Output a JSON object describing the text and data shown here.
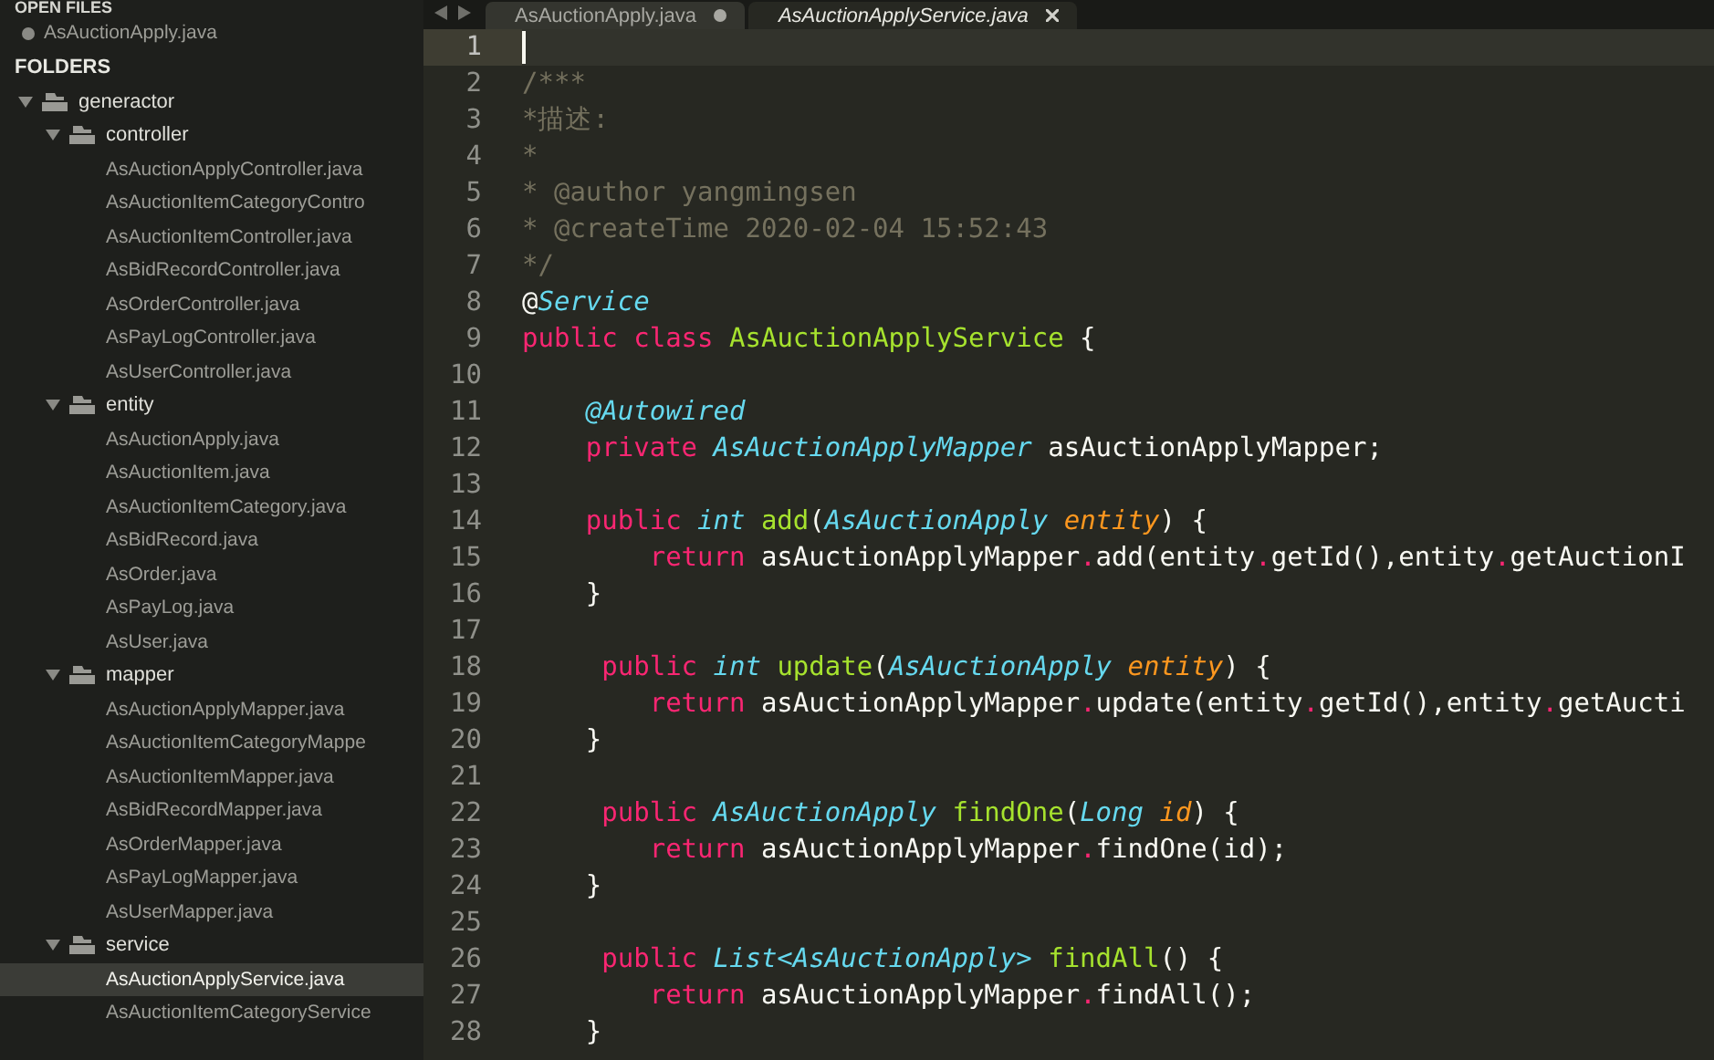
{
  "sidebar": {
    "open_files_header": "OPEN FILES",
    "open_files": [
      {
        "name": "AsAuctionApply.java"
      }
    ],
    "folders_header": "FOLDERS",
    "tree": [
      {
        "name": "generactor",
        "kind": "folder",
        "expanded": true,
        "children": [
          {
            "name": "controller",
            "kind": "folder",
            "expanded": true,
            "children": [
              {
                "name": "AsAuctionApplyController.java",
                "kind": "file",
                "selected": false
              },
              {
                "name": "AsAuctionItemCategoryContro",
                "kind": "file",
                "selected": false
              },
              {
                "name": "AsAuctionItemController.java",
                "kind": "file",
                "selected": false
              },
              {
                "name": "AsBidRecordController.java",
                "kind": "file",
                "selected": false
              },
              {
                "name": "AsOrderController.java",
                "kind": "file",
                "selected": false
              },
              {
                "name": "AsPayLogController.java",
                "kind": "file",
                "selected": false
              },
              {
                "name": "AsUserController.java",
                "kind": "file",
                "selected": false
              }
            ]
          },
          {
            "name": "entity",
            "kind": "folder",
            "expanded": true,
            "children": [
              {
                "name": "AsAuctionApply.java",
                "kind": "file",
                "selected": false
              },
              {
                "name": "AsAuctionItem.java",
                "kind": "file",
                "selected": false
              },
              {
                "name": "AsAuctionItemCategory.java",
                "kind": "file",
                "selected": false
              },
              {
                "name": "AsBidRecord.java",
                "kind": "file",
                "selected": false
              },
              {
                "name": "AsOrder.java",
                "kind": "file",
                "selected": false
              },
              {
                "name": "AsPayLog.java",
                "kind": "file",
                "selected": false
              },
              {
                "name": "AsUser.java",
                "kind": "file",
                "selected": false
              }
            ]
          },
          {
            "name": "mapper",
            "kind": "folder",
            "expanded": true,
            "children": [
              {
                "name": "AsAuctionApplyMapper.java",
                "kind": "file",
                "selected": false
              },
              {
                "name": "AsAuctionItemCategoryMappe",
                "kind": "file",
                "selected": false
              },
              {
                "name": "AsAuctionItemMapper.java",
                "kind": "file",
                "selected": false
              },
              {
                "name": "AsBidRecordMapper.java",
                "kind": "file",
                "selected": false
              },
              {
                "name": "AsOrderMapper.java",
                "kind": "file",
                "selected": false
              },
              {
                "name": "AsPayLogMapper.java",
                "kind": "file",
                "selected": false
              },
              {
                "name": "AsUserMapper.java",
                "kind": "file",
                "selected": false
              }
            ]
          },
          {
            "name": "service",
            "kind": "folder",
            "expanded": true,
            "children": [
              {
                "name": "AsAuctionApplyService.java",
                "kind": "file",
                "selected": true
              },
              {
                "name": "AsAuctionItemCategoryService",
                "kind": "file",
                "selected": false
              }
            ]
          }
        ]
      }
    ]
  },
  "tabs": [
    {
      "label": "AsAuctionApply.java",
      "selected": false,
      "modified": true
    },
    {
      "label": "AsAuctionApplyService.java",
      "selected": true,
      "modified": false
    }
  ],
  "editor": {
    "lines": [
      {
        "number": "1",
        "current": true
      },
      {
        "number": "2",
        "current": false,
        "tokens": [
          {
            "kind": "comment",
            "text": "/***"
          }
        ]
      },
      {
        "number": "3",
        "current": false,
        "tokens": [
          {
            "kind": "comment",
            "text": "*描述:"
          }
        ]
      },
      {
        "number": "4",
        "current": false,
        "tokens": [
          {
            "kind": "comment",
            "text": "*"
          }
        ]
      },
      {
        "number": "5",
        "current": false,
        "tokens": [
          {
            "kind": "comment",
            "text": "* @author yangmingsen"
          }
        ]
      },
      {
        "number": "6",
        "current": false,
        "tokens": [
          {
            "kind": "comment",
            "text": "* @createTime 2020-02-04 15:52:43"
          }
        ]
      },
      {
        "number": "7",
        "current": false,
        "tokens": [
          {
            "kind": "comment",
            "text": "*/"
          }
        ]
      },
      {
        "number": "8",
        "current": false,
        "tokens": [
          {
            "kind": "plain",
            "text": "@"
          },
          {
            "kind": "type",
            "text": "Service"
          }
        ]
      },
      {
        "number": "9",
        "current": false,
        "tokens": [
          {
            "kind": "keyword",
            "text": "public class "
          },
          {
            "kind": "func",
            "text": "AsAuctionApplyService"
          },
          {
            "kind": "plain",
            "text": " {"
          }
        ]
      },
      {
        "number": "10",
        "current": false
      },
      {
        "number": "11",
        "current": false,
        "tokens": [
          {
            "kind": "type",
            "text": "    @Autowired"
          }
        ]
      },
      {
        "number": "12",
        "current": false,
        "tokens": [
          {
            "kind": "keyword",
            "text": "    private "
          },
          {
            "kind": "type",
            "text": "AsAuctionApplyMapper"
          },
          {
            "kind": "plain",
            "text": " asAuctionApplyMapper;"
          }
        ]
      },
      {
        "number": "13",
        "current": false
      },
      {
        "number": "14",
        "current": false,
        "tokens": [
          {
            "kind": "keyword",
            "text": "    public "
          },
          {
            "kind": "type",
            "text": "int "
          },
          {
            "kind": "func",
            "text": "add"
          },
          {
            "kind": "plain",
            "text": "("
          },
          {
            "kind": "type",
            "text": "AsAuctionApply "
          },
          {
            "kind": "param",
            "text": "entity"
          },
          {
            "kind": "plain",
            "text": ") {"
          }
        ]
      },
      {
        "number": "15",
        "current": false,
        "tokens": [
          {
            "kind": "keyword",
            "text": "        return "
          },
          {
            "kind": "plain",
            "text": "asAuctionApplyMapper"
          },
          {
            "kind": "keyword",
            "text": "."
          },
          {
            "kind": "plain",
            "text": "add(entity"
          },
          {
            "kind": "keyword",
            "text": "."
          },
          {
            "kind": "plain",
            "text": "getId(),entity"
          },
          {
            "kind": "keyword",
            "text": "."
          },
          {
            "kind": "plain",
            "text": "getAuctionI"
          }
        ]
      },
      {
        "number": "16",
        "current": false,
        "tokens": [
          {
            "kind": "plain",
            "text": "    }"
          }
        ]
      },
      {
        "number": "17",
        "current": false
      },
      {
        "number": "18",
        "current": false,
        "tokens": [
          {
            "kind": "keyword",
            "text": "     public "
          },
          {
            "kind": "type",
            "text": "int "
          },
          {
            "kind": "func",
            "text": "update"
          },
          {
            "kind": "plain",
            "text": "("
          },
          {
            "kind": "type",
            "text": "AsAuctionApply "
          },
          {
            "kind": "param",
            "text": "entity"
          },
          {
            "kind": "plain",
            "text": ") {"
          }
        ]
      },
      {
        "number": "19",
        "current": false,
        "tokens": [
          {
            "kind": "keyword",
            "text": "        return "
          },
          {
            "kind": "plain",
            "text": "asAuctionApplyMapper"
          },
          {
            "kind": "keyword",
            "text": "."
          },
          {
            "kind": "plain",
            "text": "update(entity"
          },
          {
            "kind": "keyword",
            "text": "."
          },
          {
            "kind": "plain",
            "text": "getId(),entity"
          },
          {
            "kind": "keyword",
            "text": "."
          },
          {
            "kind": "plain",
            "text": "getAucti"
          }
        ]
      },
      {
        "number": "20",
        "current": false,
        "tokens": [
          {
            "kind": "plain",
            "text": "    }"
          }
        ]
      },
      {
        "number": "21",
        "current": false
      },
      {
        "number": "22",
        "current": false,
        "tokens": [
          {
            "kind": "keyword",
            "text": "     public "
          },
          {
            "kind": "type",
            "text": "AsAuctionApply "
          },
          {
            "kind": "func",
            "text": "findOne"
          },
          {
            "kind": "plain",
            "text": "("
          },
          {
            "kind": "type",
            "text": "Long "
          },
          {
            "kind": "param",
            "text": "id"
          },
          {
            "kind": "plain",
            "text": ") {"
          }
        ]
      },
      {
        "number": "23",
        "current": false,
        "tokens": [
          {
            "kind": "keyword",
            "text": "        return "
          },
          {
            "kind": "plain",
            "text": "asAuctionApplyMapper"
          },
          {
            "kind": "keyword",
            "text": "."
          },
          {
            "kind": "plain",
            "text": "findOne(id);"
          }
        ]
      },
      {
        "number": "24",
        "current": false,
        "tokens": [
          {
            "kind": "plain",
            "text": "    }"
          }
        ]
      },
      {
        "number": "25",
        "current": false
      },
      {
        "number": "26",
        "current": false,
        "tokens": [
          {
            "kind": "keyword",
            "text": "     public "
          },
          {
            "kind": "type",
            "text": "List<AsAuctionApply> "
          },
          {
            "kind": "func",
            "text": "findAll"
          },
          {
            "kind": "plain",
            "text": "() {"
          }
        ]
      },
      {
        "number": "27",
        "current": false,
        "tokens": [
          {
            "kind": "keyword",
            "text": "        return "
          },
          {
            "kind": "plain",
            "text": "asAuctionApplyMapper"
          },
          {
            "kind": "keyword",
            "text": "."
          },
          {
            "kind": "plain",
            "text": "findAll();"
          }
        ]
      },
      {
        "number": "28",
        "current": false,
        "tokens": [
          {
            "kind": "plain",
            "text": "    }"
          }
        ]
      }
    ]
  }
}
